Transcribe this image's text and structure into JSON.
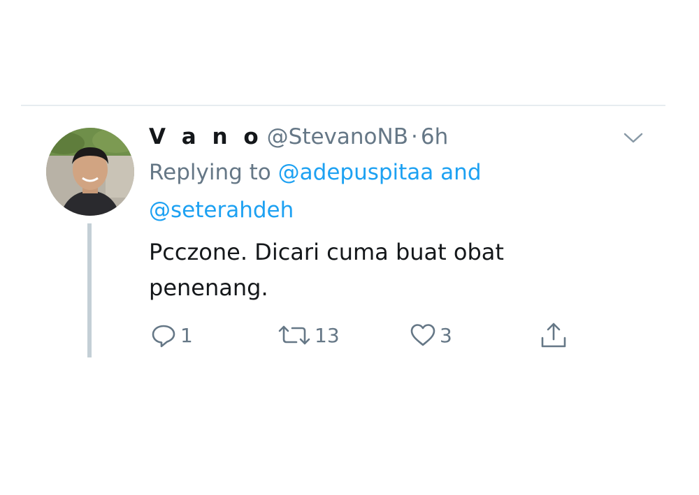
{
  "tweet": {
    "display_name": "V a n o",
    "handle": "@StevanoNB",
    "separator": "·",
    "time": "6h",
    "replying_prefix": "Replying to",
    "mention_1": "@adepuspitaa",
    "conjunction": "and",
    "mention_2": "@seterahdeh",
    "text": "Pcczone. Dicari cuma buat obat penenang."
  },
  "actions": {
    "reply_count": "1",
    "retweet_count": "13",
    "like_count": "3"
  },
  "icons": {
    "more": "chevron-down-icon",
    "reply": "reply-icon",
    "retweet": "retweet-icon",
    "like": "heart-icon",
    "share": "share-icon"
  },
  "colors": {
    "accent": "#1da1f2",
    "muted": "#657786",
    "text": "#14171a"
  }
}
